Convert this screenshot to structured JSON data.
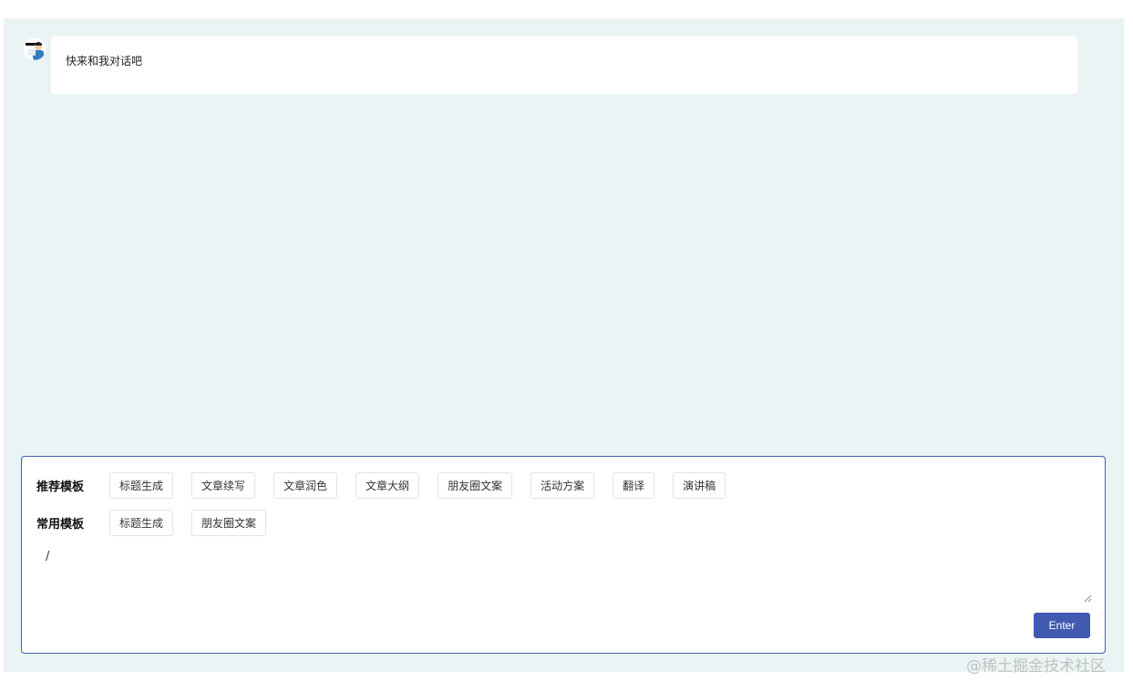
{
  "chat": {
    "greeting": "快来和我对话吧"
  },
  "templates": {
    "recommended_label": "推荐模板",
    "recommended": [
      "标题生成",
      "文章续写",
      "文章润色",
      "文章大纲",
      "朋友圈文案",
      "活动方案",
      "翻译",
      "演讲稿"
    ],
    "common_label": "常用模板",
    "common": [
      "标题生成",
      "朋友圈文案"
    ]
  },
  "input": {
    "value": "/"
  },
  "actions": {
    "enter_label": "Enter"
  },
  "watermark": "@稀土掘金技术社区",
  "colors": {
    "background": "#ebf4f4",
    "accent": "#3f5ab0",
    "panel_border": "#3d5fae"
  }
}
